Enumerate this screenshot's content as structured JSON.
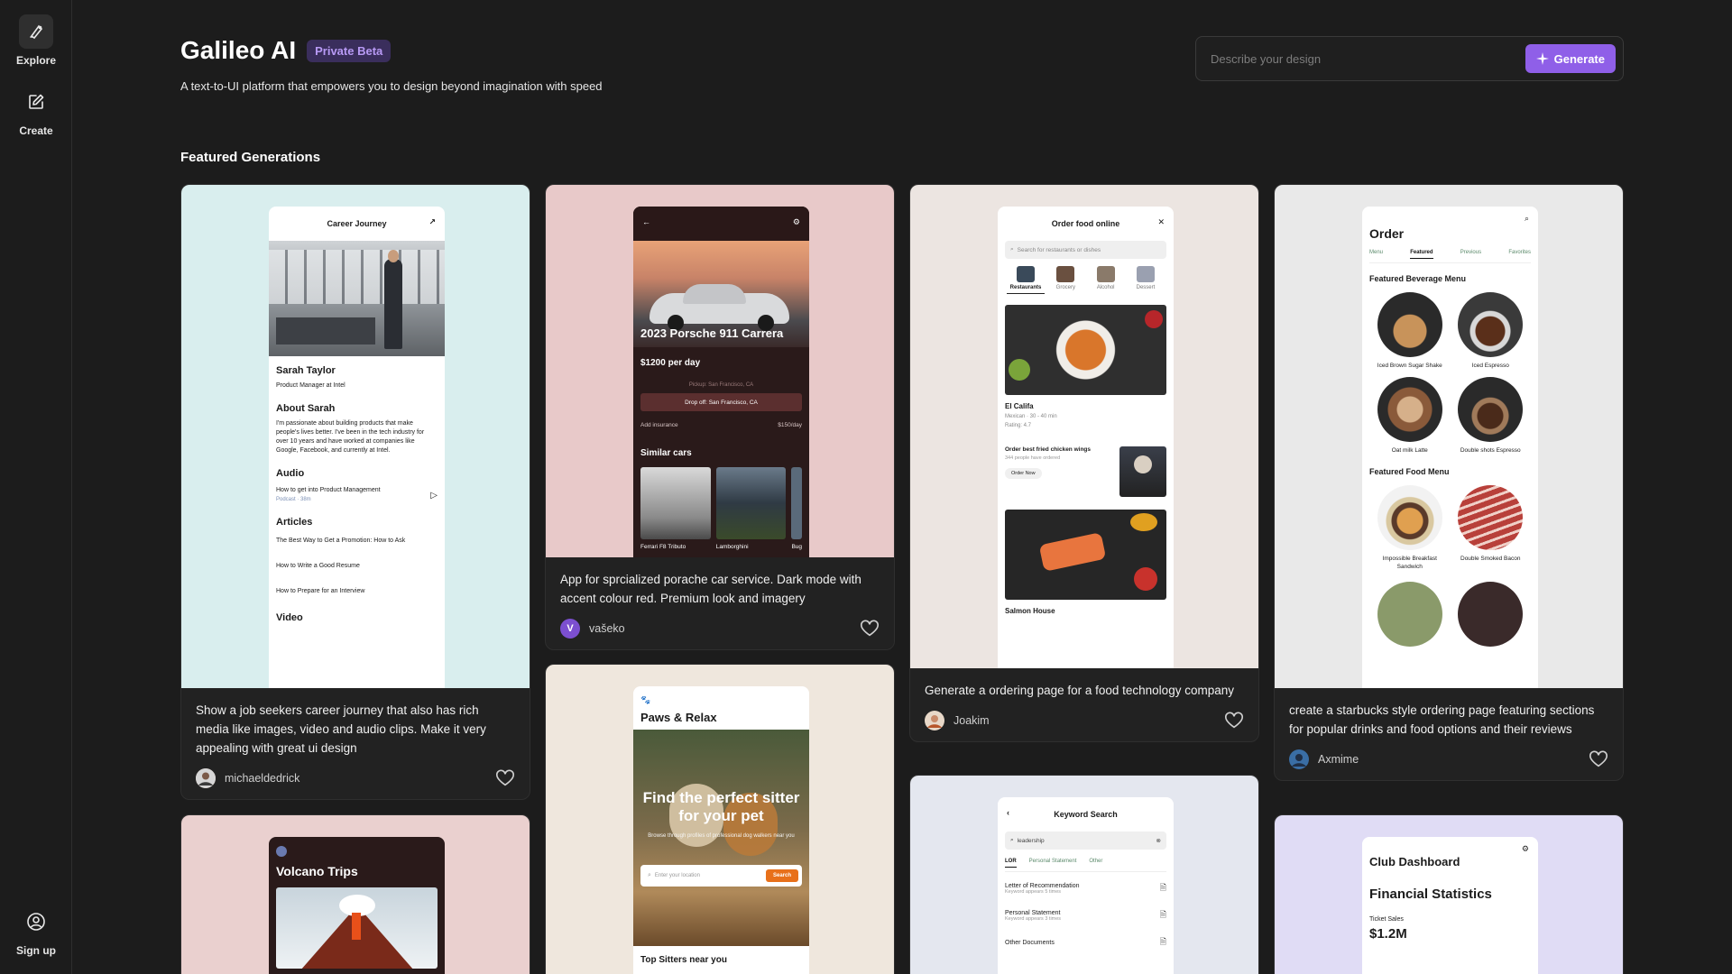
{
  "sidebar": {
    "explore_label": "Explore",
    "create_label": "Create",
    "signup_label": "Sign up"
  },
  "header": {
    "title": "Galileo AI",
    "badge": "Private Beta",
    "subtitle": "A text-to-UI platform that empowers you to design beyond imagination with speed",
    "prompt_placeholder": "Describe your design",
    "generate_label": "Generate"
  },
  "section_title": "Featured Generations",
  "cards": [
    {
      "description": "Show a job seekers career journey that also has rich media like images, video and audio clips. Make it very appealing with great ui design",
      "author": "michaeldedrick",
      "bg": "#d9eeee",
      "preview": {
        "header": "Career Journey",
        "name": "Sarah Taylor",
        "role": "Product Manager at Intel",
        "about_title": "About Sarah",
        "about_text": "I'm passionate about building products that make people's lives better. I've been in the tech industry for over 10 years and have worked at companies like Google, Facebook, and currently at Intel.",
        "audio_title": "Audio",
        "audio_item": "How to get into Product Management",
        "audio_sub": "Podcast · 38m",
        "articles_title": "Articles",
        "articles": [
          "The Best Way to Get a Promotion: How to Ask",
          "How to Write a Good Resume",
          "How to Prepare for an Interview"
        ],
        "video_title": "Video"
      }
    },
    {
      "description": "App for sprcialized porache car service. Dark mode with accent colour red. Premium look and imagery",
      "author": "vašeko",
      "avatar_letter": "V",
      "bg": "#e8c9c9",
      "preview": {
        "car_title": "2023 Porsche 911 Carrera",
        "price": "$1200 per day",
        "pickup": "Pickup: San Francisco, CA",
        "dropoff": "Drop off: San Francisco, CA",
        "insurance_label": "Add insurance",
        "insurance_price": "$150/day",
        "similar_title": "Similar cars",
        "similar": [
          "Ferrari F8 Tributo",
          "Lamborghini",
          "Bug"
        ]
      }
    },
    {
      "description": "Generate a ordering page for a food technology company",
      "author": "Joakim",
      "bg": "#ece5e1",
      "preview": {
        "header": "Order food online",
        "search": "Search for restaurants or dishes",
        "categories": [
          "Restaurants",
          "Grocery",
          "Alcohol",
          "Dessert"
        ],
        "restaurant": "El Califa",
        "restaurant_meta": "Mexican · 30 - 40 min",
        "rating": "Rating: 4.7",
        "promo_title": "Order best fried chicken wings",
        "promo_sub": "344 people have ordered",
        "promo_btn": "Order Now",
        "restaurant2": "Salmon House"
      }
    },
    {
      "description": "create a starbucks style ordering page featuring sections for popular drinks and food options and their reviews",
      "author": "Axmime",
      "bg": "#e9e9e9",
      "preview": {
        "title": "Order",
        "tabs": [
          "Menu",
          "Featured",
          "Previous",
          "Favorites"
        ],
        "beverage_title": "Featured Beverage Menu",
        "beverages": [
          "Iced Brown Sugar Shake",
          "Iced Espresso",
          "Oat milk Latte",
          "Double shots Espresso"
        ],
        "food_title": "Featured Food Menu",
        "foods": [
          "Impossible Breakfast Sandwich",
          "Double Smoked Bacon"
        ]
      }
    },
    {
      "bg": "#ead0cf",
      "preview": {
        "title": "Volcano Trips"
      }
    },
    {
      "bg": "#efe7dd",
      "preview": {
        "title": "Paws & Relax",
        "hero": "Find the perfect sitter for your pet",
        "hero_sub": "Browse through profiles of professional dog walkers near you",
        "location_placeholder": "Enter your location",
        "search_btn": "Search",
        "bottom": "Top Sitters near you"
      }
    },
    {
      "bg": "#e4e7ef",
      "preview": {
        "header": "Keyword Search",
        "query": "leadership",
        "tabs": [
          "LOR",
          "Personal Statement",
          "Other"
        ],
        "items": [
          {
            "title": "Letter of Recommendation",
            "sub": "Keyword appears 5 times"
          },
          {
            "title": "Personal Statement",
            "sub": "Keyword appears 3 times"
          },
          {
            "title": "Other Documents",
            "sub": ""
          }
        ]
      }
    },
    {
      "bg": "#e0dcf5",
      "preview": {
        "title": "Club Dashboard",
        "stats_title": "Financial Statistics",
        "ticket_label": "Ticket Sales",
        "ticket_value": "$1.2M"
      }
    }
  ]
}
